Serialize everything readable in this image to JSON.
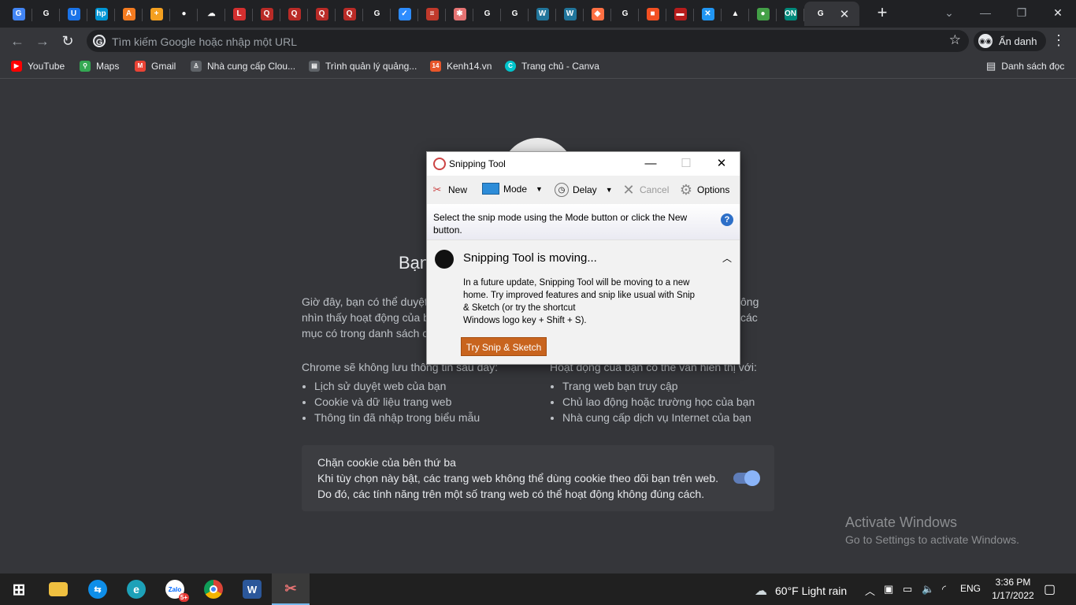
{
  "browser": {
    "tabs": [
      {
        "icon": "google-docs-icon",
        "color": "#4285f4",
        "glyph": "G"
      },
      {
        "icon": "google-icon",
        "color": "#ffffff",
        "glyph": "G"
      },
      {
        "icon": "blue-circle-icon",
        "color": "#1a73e8",
        "glyph": "U"
      },
      {
        "icon": "hp-icon",
        "color": "#0096d6",
        "glyph": "hp"
      },
      {
        "icon": "orange-icon",
        "color": "#f47b20",
        "glyph": "A"
      },
      {
        "icon": "plus-icon",
        "color": "#f4a020",
        "glyph": "+"
      },
      {
        "icon": "globe-icon",
        "color": "#ffffff",
        "glyph": "●"
      },
      {
        "icon": "cloud-icon",
        "color": "#ffffff",
        "glyph": "☁"
      },
      {
        "icon": "l-icon",
        "color": "#d32f2f",
        "glyph": "L"
      },
      {
        "icon": "q-icon",
        "color": "#b92b27",
        "glyph": "Q"
      },
      {
        "icon": "q-icon",
        "color": "#b92b27",
        "glyph": "Q"
      },
      {
        "icon": "q-icon",
        "color": "#b92b27",
        "glyph": "Q"
      },
      {
        "icon": "q-icon",
        "color": "#b92b27",
        "glyph": "Q"
      },
      {
        "icon": "google-icon",
        "color": "#ffffff",
        "glyph": "G"
      },
      {
        "icon": "check-icon",
        "color": "#2d8cff",
        "glyph": "✓"
      },
      {
        "icon": "red-stack-icon",
        "color": "#c0392b",
        "glyph": "≡"
      },
      {
        "icon": "gear-red-icon",
        "color": "#e57373",
        "glyph": "✱"
      },
      {
        "icon": "google-icon",
        "color": "#ffffff",
        "glyph": "G"
      },
      {
        "icon": "google-icon",
        "color": "#ffffff",
        "glyph": "G"
      },
      {
        "icon": "wordpress-icon",
        "color": "#21759b",
        "glyph": "W"
      },
      {
        "icon": "wordpress-icon",
        "color": "#21759b",
        "glyph": "W"
      },
      {
        "icon": "orange-diamond-icon",
        "color": "#ff7043",
        "glyph": "◆"
      },
      {
        "icon": "google-icon",
        "color": "#ffffff",
        "glyph": "G"
      },
      {
        "icon": "microsoft-icon",
        "color": "#f25022",
        "glyph": "■"
      },
      {
        "icon": "red-bar-icon",
        "color": "#b71c1c",
        "glyph": "▬"
      },
      {
        "icon": "x-blue-icon",
        "color": "#2196f3",
        "glyph": "✕"
      },
      {
        "icon": "drive-icon",
        "color": "#ffffff",
        "glyph": "▲"
      },
      {
        "icon": "person-green-icon",
        "color": "#43a047",
        "glyph": "●"
      },
      {
        "icon": "on-icon",
        "color": "#00897b",
        "glyph": "ON"
      },
      {
        "icon": "google-icon",
        "color": "#ffffff",
        "glyph": "G"
      }
    ],
    "active_tab_close": "✕",
    "new_tab": "+",
    "window_controls": [
      "⌄",
      "—",
      "❐",
      "✕"
    ],
    "omnibox_placeholder": "Tìm kiếm Google hoặc nhập một URL",
    "incognito_label": "Ẩn danh",
    "bookmarks": [
      {
        "label": "YouTube",
        "icon": "youtube-icon",
        "color": "#ff0000"
      },
      {
        "label": "Maps",
        "icon": "maps-icon",
        "color": "#34a853"
      },
      {
        "label": "Gmail",
        "icon": "gmail-icon",
        "color": "#ea4335"
      },
      {
        "label": "Nhà cung cấp Clou...",
        "icon": "person-icon",
        "color": "#5f6368"
      },
      {
        "label": "Trình quản lý quảng...",
        "icon": "ads-icon",
        "color": "#5f6368"
      },
      {
        "label": "Kenh14.vn",
        "icon": "kenh14-icon",
        "color": "#e8562a"
      },
      {
        "label": "Trang chủ - Canva",
        "icon": "canva-icon",
        "color": "#00c4cc"
      }
    ],
    "reading_list": "Danh sách đọc"
  },
  "page": {
    "title": "Bạn",
    "intro": "Giờ đây, bạn có thể duyệt ... nhìn thấy hoạt động của b ... mục có trong danh sách c",
    "intro_left_lines": [
      "Giờ đây, bạn có thể duyệt",
      "nhìn thấy hoạt động của b",
      "mục có trong danh sách c"
    ],
    "intro_right_lines": [
      "ông",
      "các"
    ],
    "col1_heading": "Chrome sẽ không lưu thông tin sau đây:",
    "col1_items": [
      "Lịch sử duyệt web của bạn",
      "Cookie và dữ liệu trang web",
      "Thông tin đã nhập trong biểu mẫu"
    ],
    "col2_heading": "Hoạt động của bạn có thể vẫn hiển thị với:",
    "col2_items": [
      "Trang web bạn truy cập",
      "Chủ lao động hoặc trường học của bạn",
      "Nhà cung cấp dịch vụ Internet của bạn"
    ],
    "cookie_title": "Chặn cookie của bên thứ ba",
    "cookie_desc1": "Khi tùy chọn này bật, các trang web không thể dùng cookie theo dõi bạn trên web.",
    "cookie_desc2": "Do đó, các tính năng trên một số trang web có thể hoạt động không đúng cách.",
    "cookie_toggle_on": true,
    "activate_title": "Activate Windows",
    "activate_sub": "Go to Settings to activate Windows."
  },
  "snipping": {
    "title": "Snipping Tool",
    "minimize": "—",
    "maximize": "☐",
    "close": "✕",
    "new": "New",
    "mode": "Mode",
    "delay": "Delay",
    "cancel": "Cancel",
    "options": "Options",
    "message": "Select the snip mode using the Mode button or click the New button.",
    "help": "?",
    "moving_title": "Snipping Tool is moving...",
    "moving_body_1": "In a future update, Snipping Tool will be moving to a new",
    "moving_body_2": "home. Try improved features and snip like usual with Snip",
    "moving_body_3": "& Sketch (or try the shortcut",
    "moving_body_4": "Windows logo key + Shift + S).",
    "try_button": "Try Snip & Sketch"
  },
  "taskbar": {
    "apps": [
      {
        "name": "start-button",
        "glyph": "⊞",
        "color": "#202020"
      },
      {
        "name": "file-explorer-icon",
        "glyph": "▬",
        "color": "#f0c040"
      },
      {
        "name": "teamviewer-icon",
        "glyph": "⇆",
        "color": "#0e8ee9"
      },
      {
        "name": "edge-icon",
        "glyph": "e",
        "color": "#1da1b8"
      },
      {
        "name": "zalo-icon",
        "glyph": "Zalo",
        "color": "#ffffff"
      },
      {
        "name": "chrome-icon",
        "glyph": "◉",
        "color": "#db4437"
      },
      {
        "name": "word-icon",
        "glyph": "W",
        "color": "#2b579a"
      },
      {
        "name": "snipping-tool-taskbar-icon",
        "glyph": "✂",
        "color": "#e0e0e0"
      }
    ],
    "zalo_badge": "5+",
    "weather": "60°F  Light rain",
    "language": "ENG",
    "time": "3:36 PM",
    "date": "1/17/2022"
  }
}
